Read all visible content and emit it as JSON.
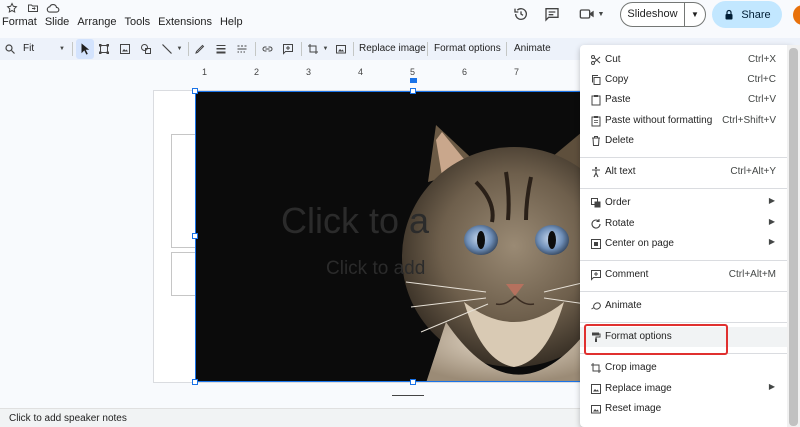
{
  "menubar": {
    "items": [
      "Format",
      "Slide",
      "Arrange",
      "Tools",
      "Extensions",
      "Help"
    ]
  },
  "header": {
    "slideshow_label": "Slideshow",
    "share_label": "Share"
  },
  "toolbar": {
    "zoom_value": "Fit",
    "replace_image_label": "Replace image",
    "format_options_label": "Format options",
    "animate_label": "Animate"
  },
  "ruler": {
    "labels": [
      "1",
      "2",
      "3",
      "4",
      "5",
      "6",
      "7"
    ]
  },
  "slide": {
    "title_placeholder": "Click to add title",
    "subtitle_placeholder": "Click to add subtitle"
  },
  "notes": {
    "placeholder": "Click to add speaker notes"
  },
  "context_menu": {
    "items": [
      {
        "label": "Cut",
        "shortcut": "Ctrl+X",
        "icon": "scissors-icon"
      },
      {
        "label": "Copy",
        "shortcut": "Ctrl+C",
        "icon": "copy-icon"
      },
      {
        "label": "Paste",
        "shortcut": "Ctrl+V",
        "icon": "paste-icon"
      },
      {
        "label": "Paste without formatting",
        "shortcut": "Ctrl+Shift+V",
        "icon": "paste-plain-icon"
      },
      {
        "label": "Delete",
        "shortcut": "",
        "icon": "trash-icon"
      },
      {
        "label": "Alt text",
        "shortcut": "Ctrl+Alt+Y",
        "icon": "accessibility-icon"
      },
      {
        "label": "Order",
        "shortcut": "",
        "icon": "order-icon"
      },
      {
        "label": "Rotate",
        "shortcut": "",
        "icon": "rotate-icon"
      },
      {
        "label": "Center on page",
        "shortcut": "",
        "icon": "center-icon"
      },
      {
        "label": "Comment",
        "shortcut": "Ctrl+Alt+M",
        "icon": "comment-add-icon"
      },
      {
        "label": "Animate",
        "shortcut": "",
        "icon": "animate-icon"
      },
      {
        "label": "Format options",
        "shortcut": "",
        "icon": "format-paint-icon"
      },
      {
        "label": "Crop image",
        "shortcut": "",
        "icon": "crop-icon"
      },
      {
        "label": "Replace image",
        "shortcut": "",
        "icon": "image-replace-icon"
      },
      {
        "label": "Reset image",
        "shortcut": "",
        "icon": "image-reset-icon"
      }
    ]
  },
  "colors": {
    "accent": "#1a73e8",
    "share_bg": "#c2e7ff",
    "highlight_box": "#e0302f",
    "avatar": "#e8710a"
  }
}
